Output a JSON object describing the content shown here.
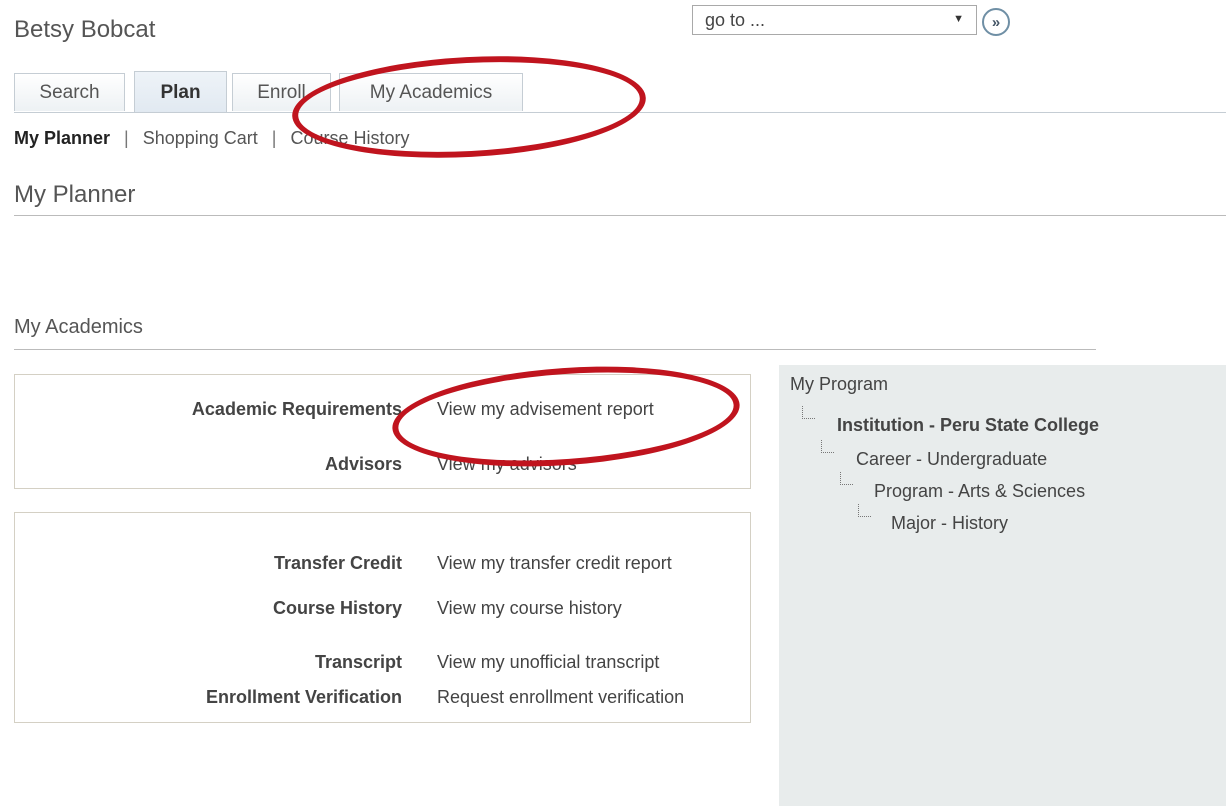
{
  "header": {
    "user_name": "Betsy Bobcat",
    "goto": {
      "value": "go to ...",
      "arrow_glyph": "▼",
      "go_glyph": "»"
    }
  },
  "tabs": [
    {
      "label": "Search",
      "active": false
    },
    {
      "label": "Plan",
      "active": true
    },
    {
      "label": "Enroll",
      "active": false
    },
    {
      "label": "My Academics",
      "active": false
    }
  ],
  "subnav": {
    "items": [
      "My Planner",
      "Shopping Cart",
      "Course History"
    ],
    "separator": "|"
  },
  "page_title": "My Planner",
  "my_academics": {
    "title": "My Academics",
    "box1": [
      {
        "label": "Academic Requirements",
        "link": "View my advisement report"
      },
      {
        "label": "Advisors",
        "link": "View my advisors"
      }
    ],
    "box2": [
      {
        "label": "Transfer Credit",
        "link": "View my transfer credit report"
      },
      {
        "label": "Course History",
        "link": "View my course history"
      },
      {
        "label": "Transcript",
        "link": "View my unofficial transcript"
      },
      {
        "label": "Enrollment Verification",
        "link": "Request enrollment verification"
      }
    ]
  },
  "my_program": {
    "title": "My Program",
    "tree": [
      "Institution - Peru State College",
      "Career - Undergraduate",
      "Program - Arts & Sciences",
      "Major - History"
    ]
  },
  "colors": {
    "highlight": "#c0141e",
    "panel_bg": "#e8ecec",
    "tab_border": "#c5cdd4"
  }
}
